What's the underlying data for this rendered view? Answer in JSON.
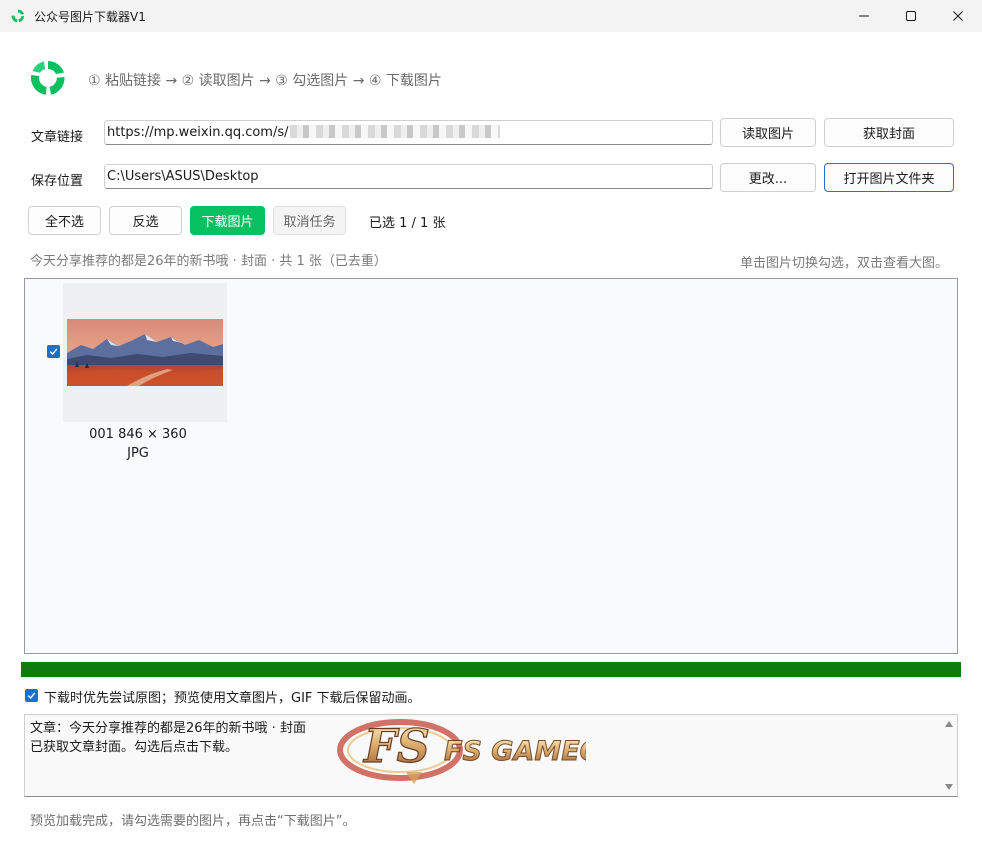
{
  "window": {
    "title": "公众号图片下载器V1",
    "icon": "app-logo-icon",
    "minimize": "minimize-icon",
    "maximize": "maximize-icon",
    "close": "close-icon"
  },
  "header": {
    "steps": "① 粘贴链接 → ② 读取图片 → ③ 勾选图片 → ④ 下载图片"
  },
  "link": {
    "label": "文章链接",
    "value": "https://mp.weixin.qq.com/s/",
    "read_button": "读取图片",
    "cover_button": "获取封面"
  },
  "save": {
    "label": "保存位置",
    "value": "C:\\Users\\ASUS\\Desktop",
    "change_button": "更改...",
    "open_folder_button": "打开图片文件夹"
  },
  "toolbar": {
    "select_none": "全不选",
    "invert": "反选",
    "download": "下载图片",
    "cancel": "取消任务",
    "selected_count": "已选 1 / 1 张"
  },
  "info": {
    "article": "今天分享推荐的都是26年的新书哦 · 封面 · 共 1 张（已去重）",
    "hint": "单击图片切换勾选，双击查看大图。"
  },
  "gallery": {
    "items": [
      {
        "caption": "001  846 × 360",
        "format": "JPG",
        "checked": true
      }
    ]
  },
  "progress": {
    "fraction": 1.0,
    "color": "#107c10"
  },
  "option": {
    "checked": true,
    "label": "下载时优先尝试原图；预览使用文章图片，GIF 下载后保留动画。"
  },
  "log": {
    "lines": [
      "文章：今天分享推荐的都是26年的新书哦 · 封面",
      "已获取文章封面。勾选后点击下载。"
    ]
  },
  "watermark": {
    "text": "FS GAMEO"
  },
  "status": "预览加载完成，请勾选需要的图片，再点击“下载图片”。",
  "colors": {
    "accent": "#07c160",
    "checkbox": "#1f6fc5"
  }
}
